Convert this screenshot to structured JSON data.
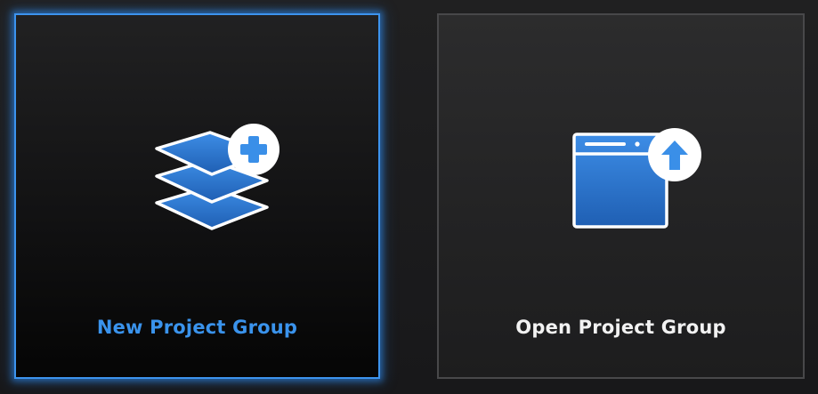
{
  "cards": {
    "new_project_group": {
      "label": "New Project Group",
      "icon": "stacked-layers-plus-icon",
      "selected": true
    },
    "open_project_group": {
      "label": "Open Project Group",
      "icon": "window-upload-icon",
      "selected": false
    }
  },
  "colors": {
    "accent": "#3a93ec",
    "selected_border": "#3c93ee",
    "unselected_border": "#48484a",
    "background": "#1c1c1d",
    "label_default": "#f2f2f2"
  }
}
